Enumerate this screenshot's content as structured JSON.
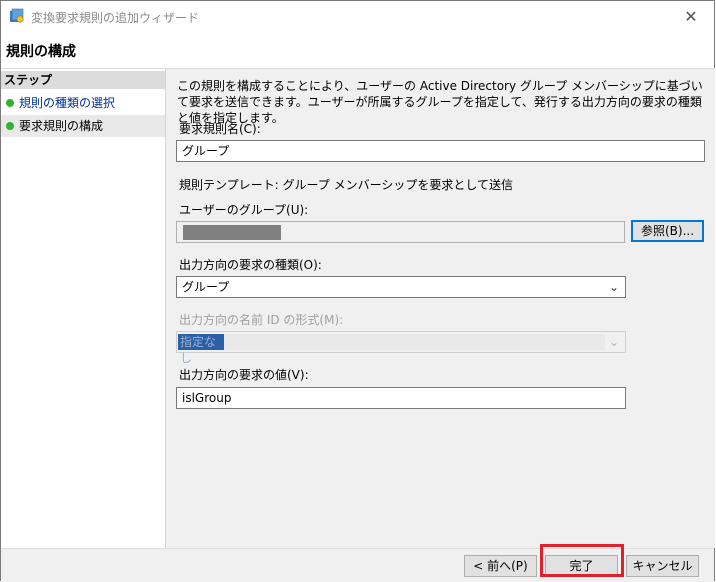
{
  "window": {
    "title": "変換要求規則の追加ウィザード",
    "close_glyph": "✕"
  },
  "header": {
    "title": "規則の構成"
  },
  "sidebar": {
    "heading": "ステップ",
    "steps": [
      {
        "label": "規則の種類の選択",
        "status": "completed"
      },
      {
        "label": "要求規則の構成",
        "status": "current"
      }
    ]
  },
  "main": {
    "description": "この規則を構成することにより、ユーザーの Active Directory グループ メンバーシップに基づいて要求を送信できます。ユーザーが所属するグループを指定して、発行する出力方向の要求の種類と値を指定します。",
    "claim_rule_name_label": "要求規則名(C):",
    "claim_rule_name_value": "グループ",
    "rule_template_text": "規則テンプレート: グループ メンバーシップを要求として送信",
    "user_group_label": "ユーザーのグループ(U):",
    "browse_button": "参照(B)...",
    "outgoing_claim_type_label": "出力方向の要求の種類(O):",
    "outgoing_claim_type_value": "グループ",
    "outgoing_name_id_format_label": "出力方向の名前 ID の形式(M):",
    "outgoing_name_id_format_value": "指定なし",
    "outgoing_claim_value_label": "出力方向の要求の値(V):",
    "outgoing_claim_value_value": "islGroup"
  },
  "footer": {
    "back_button": "< 前へ(P)",
    "finish_button": "完了",
    "cancel_button": "キャンセル"
  },
  "icons": {
    "dropdown": "chevron-down-icon",
    "step_status": "green-dot-icon",
    "app": "adfs-wizard-icon"
  },
  "colors": {
    "step_complete": "#2db52d",
    "highlight_box": "#e0202a",
    "link_blue": "#003399"
  }
}
